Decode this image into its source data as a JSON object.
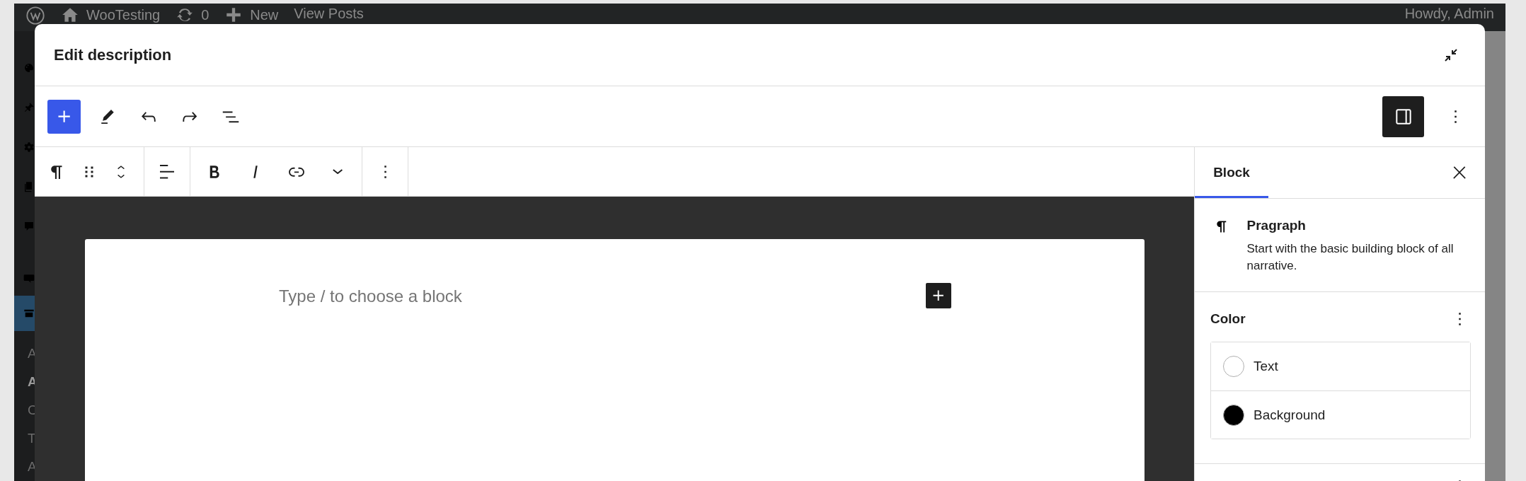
{
  "admin_bar": {
    "items": [
      {
        "kind": "logo"
      },
      {
        "kind": "site",
        "label": "WooTesting"
      },
      {
        "kind": "updates",
        "label": "0"
      },
      {
        "kind": "new",
        "label": "New"
      },
      {
        "kind": "link",
        "label": "View Posts"
      }
    ],
    "account": "Howdy, Admin"
  },
  "admin_menu": {
    "items": [
      {
        "kind": "appearance",
        "selected": false
      },
      {
        "kind": "plugins",
        "selected": false
      },
      {
        "kind": "settings",
        "selected": false
      },
      {
        "kind": "pages",
        "selected": false
      },
      {
        "kind": "comments",
        "selected": false
      },
      {
        "kind": "woocommerce",
        "selected": false
      },
      {
        "kind": "products",
        "selected": true
      }
    ],
    "submenu": [
      {
        "label": "A",
        "selected": false
      },
      {
        "label": "A",
        "selected": true
      },
      {
        "label": "C",
        "selected": false
      },
      {
        "label": "T",
        "selected": false
      },
      {
        "label": "A",
        "selected": false
      }
    ]
  },
  "modal": {
    "title": "Edit description",
    "toolbar": {
      "left": [
        {
          "kind": "inserter"
        },
        {
          "kind": "edit"
        },
        {
          "kind": "undo"
        },
        {
          "kind": "redo"
        },
        {
          "kind": "list_view"
        }
      ],
      "settings_pressed": true
    },
    "block_toolbar": [
      [
        {
          "kind": "paragraph"
        },
        {
          "kind": "drag"
        },
        {
          "kind": "mover"
        }
      ],
      [
        {
          "kind": "align"
        }
      ],
      [
        {
          "kind": "bold"
        },
        {
          "kind": "italic"
        },
        {
          "kind": "link"
        },
        {
          "kind": "more"
        }
      ],
      [
        {
          "kind": "options"
        }
      ]
    ],
    "editor": {
      "placeholder": "Type / to choose a block"
    },
    "sidebar": {
      "tabs": [
        {
          "label": "Block",
          "selected": true
        }
      ],
      "block_card": {
        "title": "Pragraph",
        "description": "Start with the basic building block of all narrative."
      },
      "panels": [
        {
          "title": "Color",
          "items": [
            {
              "label": "Text",
              "color": "#ffffff"
            },
            {
              "label": "Background",
              "color": "#000000"
            }
          ]
        }
      ]
    }
  }
}
